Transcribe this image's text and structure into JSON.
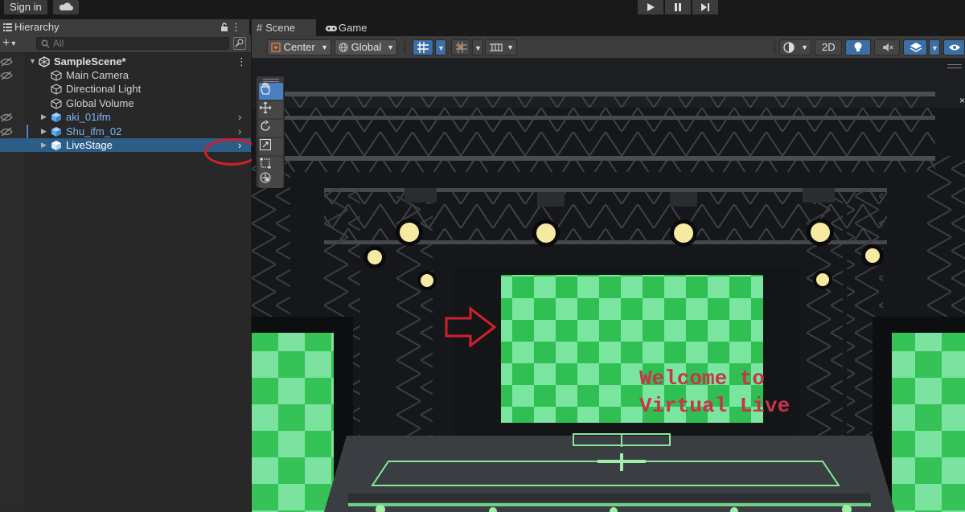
{
  "toolbar": {
    "sign_in_label": "Sign in",
    "cloud_icon": "cloud-icon",
    "play_icons": [
      "play-icon",
      "pause-icon",
      "step-icon"
    ]
  },
  "hierarchy": {
    "tab_label": "Hierarchy",
    "search_placeholder": "All",
    "items": [
      {
        "label": "SampleScene*",
        "type": "scene",
        "depth": 0,
        "eye_hidden": true
      },
      {
        "label": "Main Camera",
        "type": "gameobject",
        "depth": 1,
        "eye_hidden": true
      },
      {
        "label": "Directional Light",
        "type": "gameobject",
        "depth": 1,
        "eye_hidden": false
      },
      {
        "label": "Global Volume",
        "type": "gameobject",
        "depth": 1,
        "eye_hidden": false
      },
      {
        "label": "aki_01ifm",
        "type": "prefab",
        "depth": 1,
        "eye_hidden": true
      },
      {
        "label": "Shu_ifm_02",
        "type": "prefab",
        "depth": 1,
        "eye_hidden": true
      },
      {
        "label": "LiveStage",
        "type": "prefab",
        "depth": 1,
        "selected": true
      }
    ]
  },
  "scene_view": {
    "tabs": [
      {
        "label": "Scene",
        "active": true,
        "icon": "grid-hash-icon"
      },
      {
        "label": "Game",
        "active": false,
        "icon": "gamepad-icon"
      }
    ],
    "pivot_mode": "Center",
    "pivot_rotation": "Global",
    "mode_2d_label": "2D",
    "stage_text_line1": "Welcome to",
    "stage_text_line2": "Virtual Live",
    "colors": {
      "selection": "#2c5d87",
      "prefab_text": "#7bb6f0",
      "annotation_red": "#d31f2a",
      "checker_light": "#79e59e",
      "checker_dark": "#2fbf53"
    }
  }
}
